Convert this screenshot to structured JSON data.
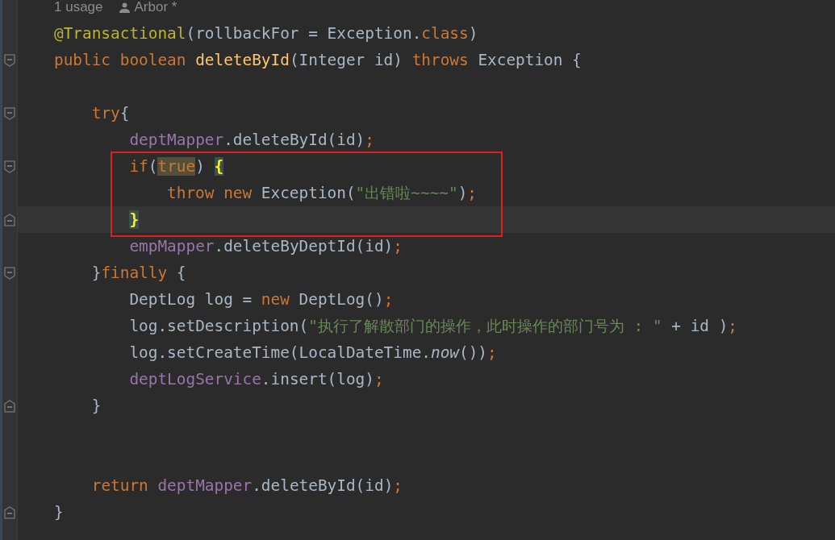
{
  "hint": {
    "usages": "1 usage",
    "author": "Arbor *"
  },
  "lines": [
    {
      "kind": "code",
      "tokens": [
        {
          "text": "@Transactional",
          "kind": "annotation"
        },
        {
          "text": "(rollbackFor = Exception.",
          "kind": "plain"
        },
        {
          "text": "class",
          "kind": "keyword"
        },
        {
          "text": ")",
          "kind": "plain"
        }
      ]
    },
    {
      "kind": "code",
      "fold_start": true,
      "tokens": [
        {
          "text": "public boolean ",
          "kind": "keyword"
        },
        {
          "text": "deleteById",
          "kind": "declaration"
        },
        {
          "text": "(Integer id) ",
          "kind": "plain"
        },
        {
          "text": "throws ",
          "kind": "keyword"
        },
        {
          "text": "Exception {",
          "kind": "plain"
        }
      ]
    },
    {
      "kind": "blank"
    },
    {
      "kind": "code",
      "fold_start": true,
      "tokens": [
        {
          "text": "    try",
          "kind": "keyword"
        },
        {
          "text": "{",
          "kind": "plain"
        }
      ]
    },
    {
      "kind": "code",
      "tokens": [
        {
          "text": "        deptMapper",
          "kind": "field"
        },
        {
          "text": ".deleteById(id)",
          "kind": "plain"
        },
        {
          "text": ";",
          "kind": "punct"
        }
      ]
    },
    {
      "kind": "code",
      "boxed": true,
      "fold_start": true,
      "tokens": [
        {
          "text": "        if",
          "kind": "keyword"
        },
        {
          "text": "(",
          "kind": "plain"
        },
        {
          "text": "true",
          "kind": "highlighted"
        },
        {
          "text": ") ",
          "kind": "plain"
        },
        {
          "text": "{",
          "kind": "bracematch"
        }
      ]
    },
    {
      "kind": "code",
      "boxed": true,
      "tokens": [
        {
          "text": "            throw new ",
          "kind": "keyword"
        },
        {
          "text": "Exception(",
          "kind": "plain"
        },
        {
          "text": "\"出错啦~~~~\"",
          "kind": "string"
        },
        {
          "text": ")",
          "kind": "plain"
        },
        {
          "text": ";",
          "kind": "punct"
        }
      ]
    },
    {
      "kind": "code",
      "current": true,
      "boxed": true,
      "fold_end": true,
      "tokens": [
        {
          "text": "        }",
          "kind": "bracematch"
        }
      ]
    },
    {
      "kind": "code",
      "tokens": [
        {
          "text": "        empMapper",
          "kind": "field"
        },
        {
          "text": ".deleteByDeptId(id)",
          "kind": "plain"
        },
        {
          "text": ";",
          "kind": "punct"
        }
      ]
    },
    {
      "kind": "code",
      "fold_start": true,
      "tokens": [
        {
          "text": "    }",
          "kind": "plain"
        },
        {
          "text": "finally ",
          "kind": "keyword"
        },
        {
          "text": "{",
          "kind": "plain"
        }
      ]
    },
    {
      "kind": "code",
      "tokens": [
        {
          "text": "        DeptLog log = ",
          "kind": "plain"
        },
        {
          "text": "new ",
          "kind": "keyword"
        },
        {
          "text": "DeptLog()",
          "kind": "plain"
        },
        {
          "text": ";",
          "kind": "punct"
        }
      ]
    },
    {
      "kind": "code",
      "tokens": [
        {
          "text": "        log.setDescription(",
          "kind": "plain"
        },
        {
          "text": "\"执行了解散部门的操作，此时操作的部门号为 : \"",
          "kind": "string"
        },
        {
          "text": " + id )",
          "kind": "plain"
        },
        {
          "text": ";",
          "kind": "punct"
        }
      ]
    },
    {
      "kind": "code",
      "tokens": [
        {
          "text": "        log.setCreateTime(LocalDateTime.",
          "kind": "plain"
        },
        {
          "text": "now",
          "kind": "static"
        },
        {
          "text": "())",
          "kind": "plain"
        },
        {
          "text": ";",
          "kind": "punct"
        }
      ]
    },
    {
      "kind": "code",
      "tokens": [
        {
          "text": "        deptLogService",
          "kind": "field"
        },
        {
          "text": ".insert(log)",
          "kind": "plain"
        },
        {
          "text": ";",
          "kind": "punct"
        }
      ]
    },
    {
      "kind": "code",
      "fold_end": true,
      "tokens": [
        {
          "text": "    }",
          "kind": "plain"
        }
      ]
    },
    {
      "kind": "blank"
    },
    {
      "kind": "blank"
    },
    {
      "kind": "code",
      "tokens": [
        {
          "text": "    return ",
          "kind": "keyword"
        },
        {
          "text": "deptMapper",
          "kind": "field"
        },
        {
          "text": ".deleteById(id)",
          "kind": "plain"
        },
        {
          "text": ";",
          "kind": "punct"
        }
      ]
    },
    {
      "kind": "code",
      "fold_end": true,
      "tokens": [
        {
          "text": "}",
          "kind": "plain"
        }
      ]
    }
  ]
}
